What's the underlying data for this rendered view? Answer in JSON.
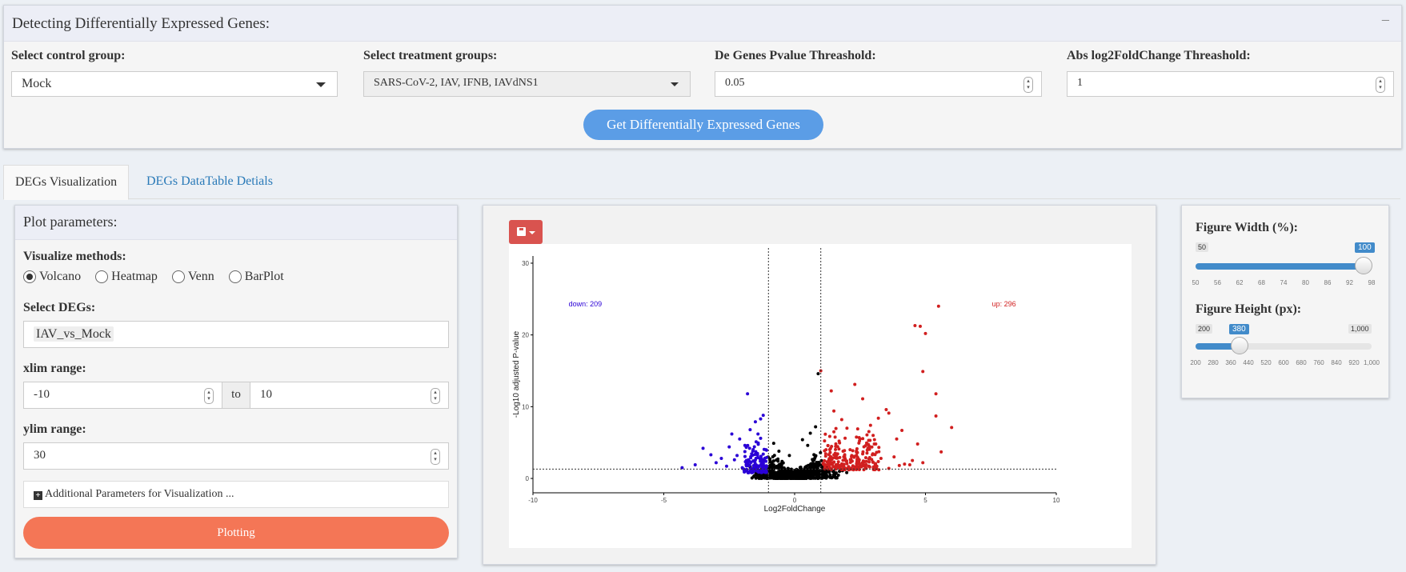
{
  "deg_panel": {
    "title": "Detecting Differentially Expressed Genes:",
    "collapse_label": "−",
    "control_label": "Select control group:",
    "control_value": "Mock",
    "treatment_label": "Select treatment groups:",
    "treatment_value": "SARS-CoV-2, IAV, IFNB, IAVdNS1",
    "pvalue_label": "De Genes Pvalue Threashold:",
    "pvalue_value": "0.05",
    "lfc_label": "Abs log2FoldChange Threashold:",
    "lfc_value": "1",
    "button_label": "Get Differentially Expressed Genes"
  },
  "tabs": [
    "DEGs Visualization",
    "DEGs DataTable Detials"
  ],
  "plot_params": {
    "title": "Plot parameters:",
    "methods_label": "Visualize methods:",
    "methods": [
      "Volcano",
      "Heatmap",
      "Venn",
      "BarPlot"
    ],
    "selected_method": "Volcano",
    "degs_label": "Select DEGs:",
    "degs_value": "IAV_vs_Mock",
    "xlim_label": "xlim range:",
    "xlim_min": "-10",
    "xlim_to": "to",
    "xlim_max": "10",
    "ylim_label": "ylim range:",
    "ylim_value": "30",
    "additional_label": "Additional Parameters for Visualization ...",
    "plot_button": "Plotting"
  },
  "figure_controls": {
    "width_label": "Figure Width (%):",
    "width_min": "50",
    "width_max": "100",
    "width_value": "100",
    "width_ticks": [
      "50",
      "56",
      "62",
      "68",
      "74",
      "80",
      "86",
      "92",
      "98"
    ],
    "height_label": "Figure Height (px):",
    "height_min": "200",
    "height_max": "1,000",
    "height_value": "380",
    "height_ticks": [
      "200",
      "280",
      "360",
      "440",
      "520",
      "600",
      "680",
      "760",
      "840",
      "920",
      "1,000"
    ],
    "slider_color": "#428bca"
  },
  "icons": {
    "save": "floppy-disk-icon",
    "dropdown": "caret-down-icon",
    "add": "plus-square-icon"
  },
  "colors": {
    "primary_button": "#5b9de6",
    "plot_button": "#f47656",
    "save_button": "#d9534f",
    "down": "#2a00d6",
    "up": "#d11f1f"
  },
  "chart_data": {
    "type": "scatter",
    "xlabel": "Log2FoldChange",
    "ylabel": "-Log10 adjusted P-value",
    "xlim": [
      -10,
      10
    ],
    "ylim": [
      0,
      30
    ],
    "x_ticks": [
      "-10",
      "-5",
      "0",
      "5",
      "10"
    ],
    "y_ticks": [
      "0",
      "10",
      "20",
      "30"
    ],
    "lfc_threshold": 1,
    "pvalue_threshold_line": 1.3,
    "annotations": [
      {
        "text": "down: 209",
        "x": -8.0,
        "y": 24,
        "color": "#2a00d6"
      },
      {
        "text": "up: 296",
        "x": 8.0,
        "y": 24,
        "color": "#d11f1f"
      }
    ],
    "up_points": [
      [
        5.5,
        24
      ],
      [
        4.6,
        21.3
      ],
      [
        4.8,
        21.2
      ],
      [
        5.0,
        20.2
      ],
      [
        4.9,
        14.9
      ],
      [
        5.4,
        11.8
      ],
      [
        5.4,
        8.7
      ],
      [
        6.0,
        7.1
      ],
      [
        5.6,
        3.7
      ],
      [
        4.7,
        4.8
      ],
      [
        3.5,
        9.6
      ],
      [
        3.6,
        9.1
      ],
      [
        2.3,
        13.1
      ],
      [
        1.4,
        12.2
      ],
      [
        1.0,
        15.0
      ],
      [
        2.6,
        11.1
      ],
      [
        1.8,
        8.2
      ],
      [
        2.0,
        7.0
      ],
      [
        1.5,
        6.5
      ],
      [
        2.5,
        5.5
      ],
      [
        3.0,
        6.0
      ],
      [
        3.8,
        3.0
      ],
      [
        4.2,
        2.0
      ],
      [
        4.5,
        2.5
      ],
      [
        2.8,
        4.2
      ],
      [
        1.2,
        4.0
      ],
      [
        1.6,
        3.2
      ],
      [
        2.2,
        2.4
      ],
      [
        3.3,
        2.8
      ],
      [
        4.0,
        1.8
      ],
      [
        1.1,
        2.0
      ],
      [
        1.3,
        1.7
      ],
      [
        1.9,
        1.5
      ],
      [
        2.7,
        1.6
      ],
      [
        3.6,
        1.4
      ],
      [
        4.4,
        1.9
      ],
      [
        4.9,
        2.2
      ],
      [
        2.4,
        3.6
      ],
      [
        3.1,
        4.8
      ],
      [
        1.7,
        5.2
      ],
      [
        2.9,
        7.4
      ],
      [
        3.2,
        8.4
      ],
      [
        1.5,
        9.4
      ],
      [
        3.9,
        5.5
      ],
      [
        4.1,
        6.7
      ]
    ],
    "down_points": [
      [
        -1.8,
        11.8
      ],
      [
        -1.2,
        8.8
      ],
      [
        -1.3,
        8.3
      ],
      [
        -1.5,
        7.9
      ],
      [
        -2.4,
        6.2
      ],
      [
        -2.1,
        5.5
      ],
      [
        -3.5,
        4.2
      ],
      [
        -3.2,
        3.3
      ],
      [
        -4.3,
        1.5
      ],
      [
        -3.0,
        2.2
      ],
      [
        -2.6,
        1.7
      ],
      [
        -2.2,
        3.2
      ],
      [
        -1.9,
        4.6
      ],
      [
        -1.6,
        3.8
      ],
      [
        -1.4,
        2.9
      ],
      [
        -1.2,
        2.2
      ],
      [
        -1.1,
        1.6
      ],
      [
        -1.5,
        1.8
      ],
      [
        -1.8,
        2.5
      ],
      [
        -2.0,
        1.5
      ],
      [
        -2.8,
        2.8
      ],
      [
        -1.3,
        5.6
      ],
      [
        -1.7,
        6.8
      ],
      [
        -2.3,
        2.6
      ],
      [
        -1.1,
        4.0
      ],
      [
        -1.6,
        1.3
      ],
      [
        -2.5,
        4.4
      ],
      [
        -3.8,
        1.9
      ],
      [
        -1.4,
        6.2
      ],
      [
        -1.2,
        3.4
      ]
    ]
  }
}
